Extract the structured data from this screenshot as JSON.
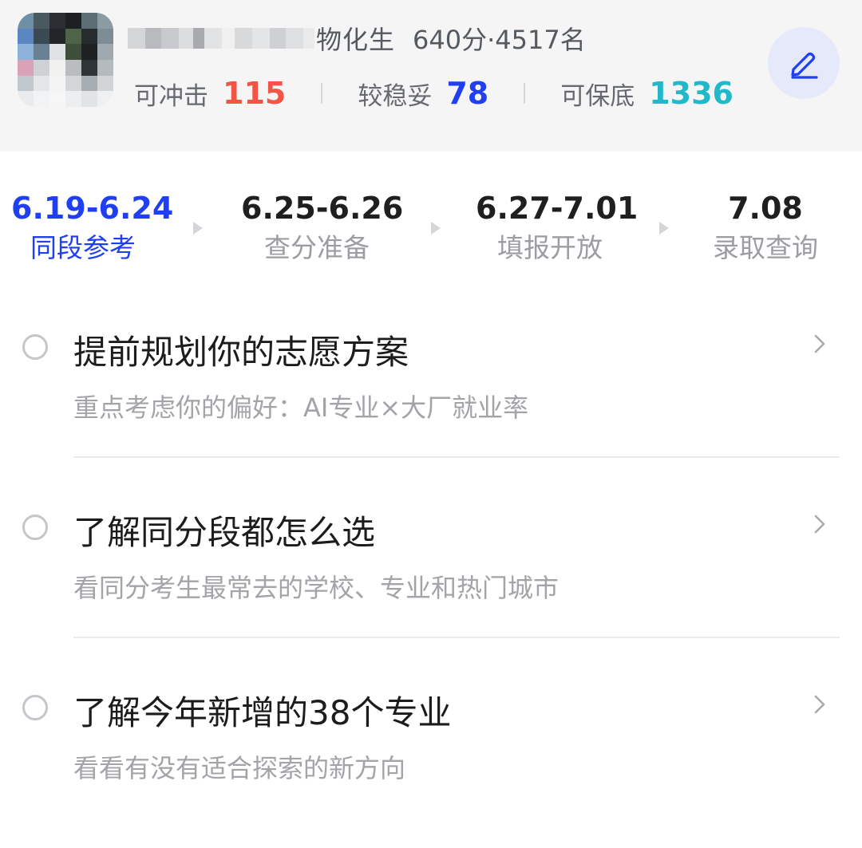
{
  "profile": {
    "name_suffix": "物化生",
    "score_rank": "640分·4517名",
    "stats": [
      {
        "label": "可冲击",
        "value": "115",
        "color": "#f25545"
      },
      {
        "label": "较稳妥",
        "value": "78",
        "color": "#1f3ff0"
      },
      {
        "label": "可保底",
        "value": "1336",
        "color": "#21b8c9"
      }
    ],
    "edit_icon": "pencil-icon"
  },
  "timeline": {
    "steps": [
      {
        "date": "6.19-6.24",
        "label": "同段参考",
        "active": true
      },
      {
        "date": "6.25-6.26",
        "label": "查分准备",
        "active": false
      },
      {
        "date": "6.27-7.01",
        "label": "填报开放",
        "active": false
      },
      {
        "date": "7.08",
        "label": "录取查询",
        "active": false
      }
    ]
  },
  "tasks": [
    {
      "title": "提前规划你的志愿方案",
      "subtitle": "重点考虑你的偏好：AI专业×大厂就业率"
    },
    {
      "title": "了解同分段都怎么选",
      "subtitle": "看同分考生最常去的学校、专业和热门城市"
    },
    {
      "title": "了解今年新增的38个专业",
      "subtitle": "看看有没有适合探索的新方向"
    }
  ],
  "colors": {
    "accent": "#1f3ff0",
    "rush": "#f25545",
    "safe": "#1f3ff0",
    "guarantee": "#21b8c9"
  }
}
